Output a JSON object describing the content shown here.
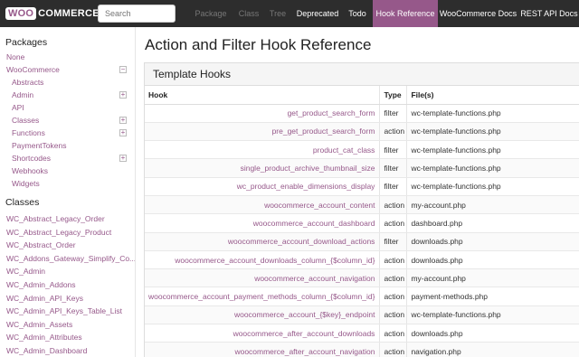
{
  "brand": {
    "woo": "WOO",
    "commerce": "COMMERCE"
  },
  "search": {
    "placeholder": "Search"
  },
  "nav": [
    {
      "label": "Package",
      "state": "muted"
    },
    {
      "label": "Class",
      "state": "muted"
    },
    {
      "label": "Tree",
      "state": "muted"
    },
    {
      "label": "Deprecated",
      "state": "active"
    },
    {
      "label": "Todo",
      "state": "active"
    },
    {
      "label": "Hook Reference",
      "state": "current"
    },
    {
      "label": "WooCommerce Docs",
      "state": "active"
    },
    {
      "label": "REST API Docs",
      "state": "active"
    }
  ],
  "sidebar": {
    "packages_heading": "Packages",
    "packages": [
      {
        "label": "None",
        "sub": false,
        "toggle": ""
      },
      {
        "label": "WooCommerce",
        "sub": false,
        "toggle": "−"
      },
      {
        "label": "Abstracts",
        "sub": true,
        "toggle": ""
      },
      {
        "label": "Admin",
        "sub": true,
        "toggle": "+"
      },
      {
        "label": "API",
        "sub": true,
        "toggle": ""
      },
      {
        "label": "Classes",
        "sub": true,
        "toggle": "+"
      },
      {
        "label": "Functions",
        "sub": true,
        "toggle": "+"
      },
      {
        "label": "PaymentTokens",
        "sub": true,
        "toggle": ""
      },
      {
        "label": "Shortcodes",
        "sub": true,
        "toggle": "+"
      },
      {
        "label": "Webhooks",
        "sub": true,
        "toggle": ""
      },
      {
        "label": "Widgets",
        "sub": true,
        "toggle": ""
      }
    ],
    "classes_heading": "Classes",
    "classes": [
      "WC_Abstract_Legacy_Order",
      "WC_Abstract_Legacy_Product",
      "WC_Abstract_Order",
      "WC_Addons_Gateway_Simplify_Co...",
      "WC_Admin",
      "WC_Admin_Addons",
      "WC_Admin_API_Keys",
      "WC_Admin_API_Keys_Table_List",
      "WC_Admin_Assets",
      "WC_Admin_Attributes",
      "WC_Admin_Dashboard"
    ]
  },
  "main": {
    "title": "Action and Filter Hook Reference",
    "section_title": "Template Hooks",
    "columns": [
      "Hook",
      "Type",
      "File(s)"
    ],
    "rows": [
      [
        "get_product_search_form",
        "filter",
        "wc-template-functions.php"
      ],
      [
        "pre_get_product_search_form",
        "action",
        "wc-template-functions.php"
      ],
      [
        "product_cat_class",
        "filter",
        "wc-template-functions.php"
      ],
      [
        "single_product_archive_thumbnail_size",
        "filter",
        "wc-template-functions.php"
      ],
      [
        "wc_product_enable_dimensions_display",
        "filter",
        "wc-template-functions.php"
      ],
      [
        "woocommerce_account_content",
        "action",
        "my-account.php"
      ],
      [
        "woocommerce_account_dashboard",
        "action",
        "dashboard.php"
      ],
      [
        "woocommerce_account_download_actions",
        "filter",
        "downloads.php"
      ],
      [
        "woocommerce_account_downloads_column_{$column_id}",
        "action",
        "downloads.php"
      ],
      [
        "woocommerce_account_navigation",
        "action",
        "my-account.php"
      ],
      [
        "woocommerce_account_payment_methods_column_{$column_id}",
        "action",
        "payment-methods.php"
      ],
      [
        "woocommerce_account_{$key}_endpoint",
        "action",
        "wc-template-functions.php"
      ],
      [
        "woocommerce_after_account_downloads",
        "action",
        "downloads.php"
      ],
      [
        "woocommerce_after_account_navigation",
        "action",
        "navigation.php"
      ]
    ]
  },
  "colors": {
    "accent": "#96588a",
    "topbar": "#2d2d2d"
  }
}
